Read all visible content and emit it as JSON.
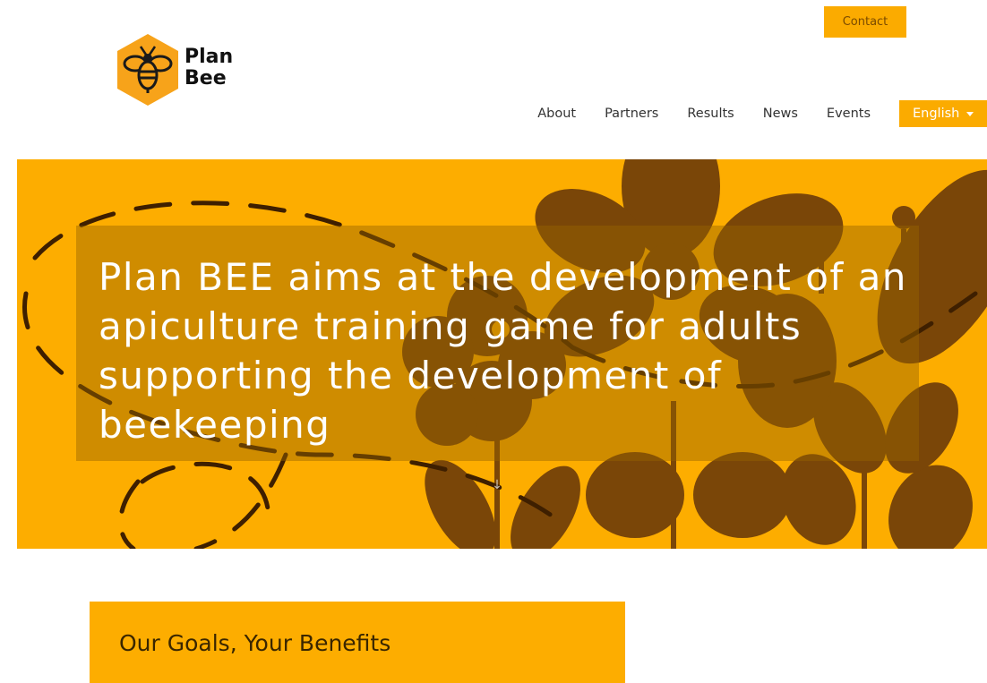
{
  "header": {
    "contact_label": "Contact",
    "logo": {
      "line1": "Plan",
      "line2": "Bee",
      "icon": "bee-hexagon-icon"
    },
    "nav": [
      "About",
      "Partners",
      "Results",
      "News",
      "Events"
    ],
    "language": {
      "selected": "English",
      "icon": "caret-down-icon"
    }
  },
  "hero": {
    "title": "Plan BEE aims at the development of an apiculture training game for adults supporting the development of beekeeping",
    "scroll_icon": "arrow-down-icon"
  },
  "goals": {
    "title": "Our Goals, Your Benefits"
  },
  "colors": {
    "accent": "#fbab00",
    "hero_background": "#fdad00",
    "flower_brown": "#7a4608",
    "nav_text": "#333333"
  }
}
